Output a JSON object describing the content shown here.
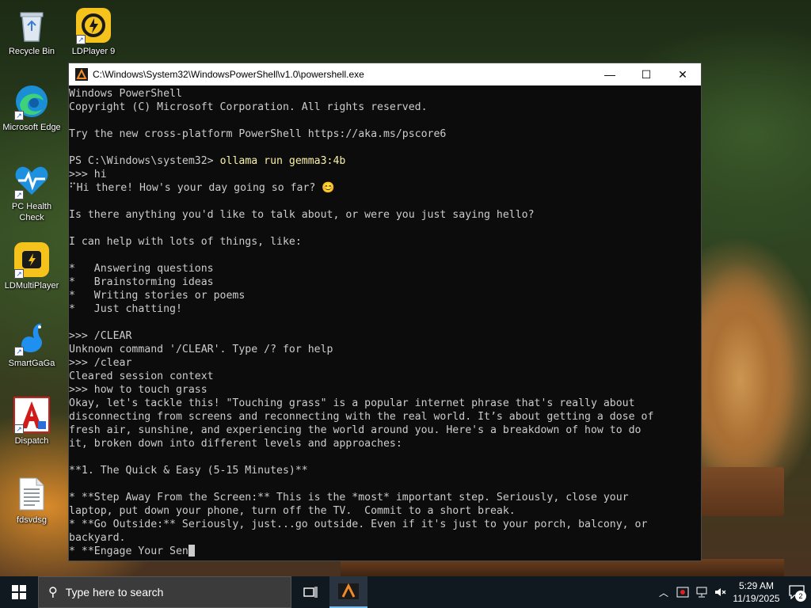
{
  "desktop": {
    "icons": [
      {
        "label": "Recycle Bin",
        "icon": "recycle-bin-icon"
      },
      {
        "label": "LDPlayer 9",
        "icon": "ldplayer-icon"
      },
      {
        "label": "Microsoft Edge",
        "icon": "edge-icon"
      },
      {
        "label": "PC Health Check",
        "icon": "pc-health-icon"
      },
      {
        "label": "LDMultiPlayer",
        "icon": "ldmultiplayer-icon"
      },
      {
        "label": "SmartGaGa",
        "icon": "smartgaga-icon"
      },
      {
        "label": "Dispatch",
        "icon": "dispatch-icon"
      },
      {
        "label": "fdsvdsg",
        "icon": "text-file-icon"
      }
    ]
  },
  "window": {
    "title": "C:\\Windows\\System32\\WindowsPowerShell\\v1.0\\powershell.exe",
    "controls": {
      "minimize": "—",
      "maximize": "☐",
      "close": "✕"
    },
    "lines": [
      {
        "text": "Windows PowerShell",
        "cmd": ""
      },
      {
        "text": "Copyright (C) Microsoft Corporation. All rights reserved.",
        "cmd": ""
      },
      {
        "text": "",
        "cmd": ""
      },
      {
        "text": "Try the new cross-platform PowerShell https://aka.ms/pscore6",
        "cmd": ""
      },
      {
        "text": "",
        "cmd": ""
      },
      {
        "text": "PS C:\\Windows\\system32> ",
        "cmd": "ollama run gemma3:4b"
      },
      {
        "text": ">>> hi",
        "cmd": ""
      },
      {
        "text": "⠋Hi there! How's your day going so far? 😊",
        "cmd": ""
      },
      {
        "text": "",
        "cmd": ""
      },
      {
        "text": "Is there anything you'd like to talk about, or were you just saying hello?",
        "cmd": ""
      },
      {
        "text": "",
        "cmd": ""
      },
      {
        "text": "I can help with lots of things, like:",
        "cmd": ""
      },
      {
        "text": "",
        "cmd": ""
      },
      {
        "text": "*   Answering questions",
        "cmd": ""
      },
      {
        "text": "*   Brainstorming ideas",
        "cmd": ""
      },
      {
        "text": "*   Writing stories or poems",
        "cmd": ""
      },
      {
        "text": "*   Just chatting!",
        "cmd": ""
      },
      {
        "text": "",
        "cmd": ""
      },
      {
        "text": ">>> /CLEAR",
        "cmd": ""
      },
      {
        "text": "Unknown command '/CLEAR'. Type /? for help",
        "cmd": ""
      },
      {
        "text": ">>> /clear",
        "cmd": ""
      },
      {
        "text": "Cleared session context",
        "cmd": ""
      },
      {
        "text": ">>> how to touch grass",
        "cmd": ""
      },
      {
        "text": "Okay, let's tackle this! \"Touching grass\" is a popular internet phrase that's really about",
        "cmd": ""
      },
      {
        "text": "disconnecting from screens and reconnecting with the real world. It’s about getting a dose of",
        "cmd": ""
      },
      {
        "text": "fresh air, sunshine, and experiencing the world around you. Here's a breakdown of how to do",
        "cmd": ""
      },
      {
        "text": "it, broken down into different levels and approaches:",
        "cmd": ""
      },
      {
        "text": "",
        "cmd": ""
      },
      {
        "text": "**1. The Quick & Easy (5-15 Minutes)**",
        "cmd": ""
      },
      {
        "text": "",
        "cmd": ""
      },
      {
        "text": "* **Step Away From the Screen:** This is the *most* important step. Seriously, close your",
        "cmd": ""
      },
      {
        "text": "laptop, put down your phone, turn off the TV.  Commit to a short break.",
        "cmd": ""
      },
      {
        "text": "* **Go Outside:** Seriously, just...go outside. Even if it's just to your porch, balcony, or",
        "cmd": ""
      },
      {
        "text": "backyard.",
        "cmd": ""
      },
      {
        "text": "* **Engage Your Sen",
        "cmd": ""
      }
    ]
  },
  "taskbar": {
    "search_placeholder": "Type here to search",
    "time": "5:29 AM",
    "date": "11/19/2025",
    "notification_count": "2"
  },
  "colors": {
    "console_bg": "#0c0c0c",
    "console_text": "#cccccc",
    "command_text": "#f9f1a5",
    "taskbar_bg": "#101820"
  }
}
